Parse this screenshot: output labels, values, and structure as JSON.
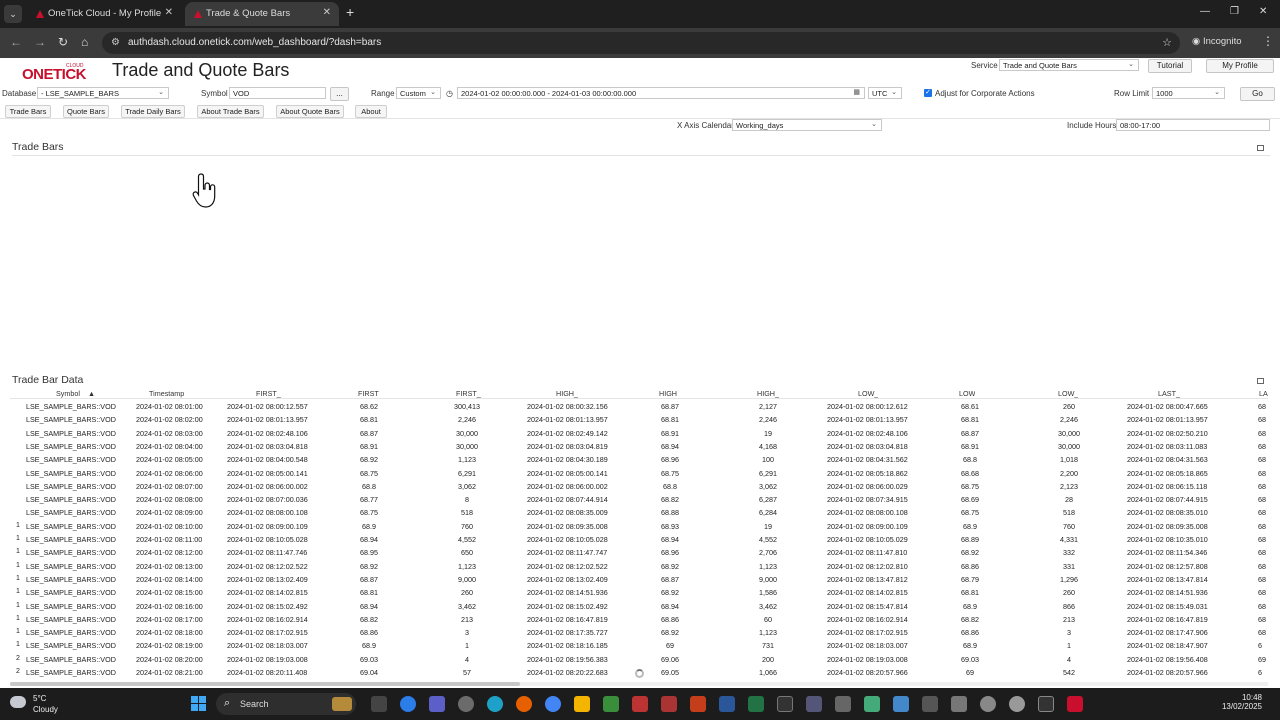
{
  "browser": {
    "tabs": [
      {
        "title": "OneTick Cloud - My Profile"
      },
      {
        "title": "Trade & Quote Bars"
      }
    ],
    "url": "authdash.cloud.onetick.com/web_dashboard/?dash=bars",
    "incognito_label": "Incognito"
  },
  "header": {
    "logo_text": "ONETICK",
    "logo_sub": "CLOUD",
    "title": "Trade and Quote Bars",
    "service_label": "Service",
    "service_value": "Trade and Quote Bars",
    "tutorial_label": "Tutorial",
    "profile_label": "My Profile"
  },
  "controls": {
    "database_label": "Database",
    "database_value": "- LSE_SAMPLE_BARS",
    "symbol_label": "Symbol",
    "symbol_value": "VOD",
    "symbol_more": "...",
    "range_label": "Range",
    "range_value": "Custom",
    "range_text": "2024-01-02 00:00:00.000 - 2024-01-03 00:00:00.000",
    "timezone": "UTC",
    "corp_actions_label": "Adjust for Corporate Actions",
    "row_limit_label": "Row Limit",
    "row_limit_value": "1000",
    "go_label": "Go"
  },
  "subtabs": [
    "Trade Bars",
    "Quote Bars",
    "Trade Daily Bars",
    "About Trade Bars",
    "About Quote Bars",
    "About"
  ],
  "options": {
    "x_axis_label": "X Axis Calendar",
    "x_axis_value": "Working_days",
    "include_hours_label": "Include Hours",
    "include_hours_value": "08:00-17:00"
  },
  "sections": {
    "chart_title": "Trade Bars",
    "table_title": "Trade Bar Data"
  },
  "table": {
    "columns": [
      "Symbol",
      "Timestamp",
      "FIRST_",
      "FIRST",
      "FIRST_",
      "HIGH_",
      "HIGH",
      "HIGH_",
      "LOW_",
      "LOW",
      "LOW_",
      "LAST_",
      "LA"
    ],
    "sort_indicator": "▲",
    "rows": [
      [
        "",
        "LSE_SAMPLE_BARS::VOD",
        "2024-01-02 08:01:00",
        "2024-01-02 08:00:12.557",
        "68.62",
        "300,413",
        "2024-01-02 08:00:32.156",
        "68.87",
        "2,127",
        "2024-01-02 08:00:12.612",
        "68.61",
        "260",
        "2024-01-02 08:00:47.665",
        "68"
      ],
      [
        "",
        "LSE_SAMPLE_BARS::VOD",
        "2024-01-02 08:02:00",
        "2024-01-02 08:01:13.957",
        "68.81",
        "2,246",
        "2024-01-02 08:01:13.957",
        "68.81",
        "2,246",
        "2024-01-02 08:01:13.957",
        "68.81",
        "2,246",
        "2024-01-02 08:01:13.957",
        "68"
      ],
      [
        "",
        "LSE_SAMPLE_BARS::VOD",
        "2024-01-02 08:03:00",
        "2024-01-02 08:02:48.106",
        "68.87",
        "30,000",
        "2024-01-02 08:02:49.142",
        "68.91",
        "19",
        "2024-01-02 08:02:48.106",
        "68.87",
        "30,000",
        "2024-01-02 08:02:50.210",
        "68"
      ],
      [
        "",
        "LSE_SAMPLE_BARS::VOD",
        "2024-01-02 08:04:00",
        "2024-01-02 08:03:04.818",
        "68.91",
        "30,000",
        "2024-01-02 08:03:04.819",
        "68.94",
        "4,168",
        "2024-01-02 08:03:04.818",
        "68.91",
        "30,000",
        "2024-01-02 08:03:11.083",
        "68"
      ],
      [
        "",
        "LSE_SAMPLE_BARS::VOD",
        "2024-01-02 08:05:00",
        "2024-01-02 08:04:00.548",
        "68.92",
        "1,123",
        "2024-01-02 08:04:30.189",
        "68.96",
        "100",
        "2024-01-02 08:04:31.562",
        "68.8",
        "1,018",
        "2024-01-02 08:04:31.563",
        "68"
      ],
      [
        "",
        "LSE_SAMPLE_BARS::VOD",
        "2024-01-02 08:06:00",
        "2024-01-02 08:05:00.141",
        "68.75",
        "6,291",
        "2024-01-02 08:05:00.141",
        "68.75",
        "6,291",
        "2024-01-02 08:05:18.862",
        "68.68",
        "2,200",
        "2024-01-02 08:05:18.865",
        "68"
      ],
      [
        "",
        "LSE_SAMPLE_BARS::VOD",
        "2024-01-02 08:07:00",
        "2024-01-02 08:06:00.002",
        "68.8",
        "3,062",
        "2024-01-02 08:06:00.002",
        "68.8",
        "3,062",
        "2024-01-02 08:06:00.029",
        "68.75",
        "2,123",
        "2024-01-02 08:06:15.118",
        "68"
      ],
      [
        "",
        "LSE_SAMPLE_BARS::VOD",
        "2024-01-02 08:08:00",
        "2024-01-02 08:07:00.036",
        "68.77",
        "8",
        "2024-01-02 08:07:44.914",
        "68.82",
        "6,287",
        "2024-01-02 08:07:34.915",
        "68.69",
        "28",
        "2024-01-02 08:07:44.915",
        "68"
      ],
      [
        "",
        "LSE_SAMPLE_BARS::VOD",
        "2024-01-02 08:09:00",
        "2024-01-02 08:08:00.108",
        "68.75",
        "518",
        "2024-01-02 08:08:35.009",
        "68.88",
        "6,284",
        "2024-01-02 08:08:00.108",
        "68.75",
        "518",
        "2024-01-02 08:08:35.010",
        "68"
      ],
      [
        "1",
        "LSE_SAMPLE_BARS::VOD",
        "2024-01-02 08:10:00",
        "2024-01-02 08:09:00.109",
        "68.9",
        "760",
        "2024-01-02 08:09:35.008",
        "68.93",
        "19",
        "2024-01-02 08:09:00.109",
        "68.9",
        "760",
        "2024-01-02 08:09:35.008",
        "68"
      ],
      [
        "1",
        "LSE_SAMPLE_BARS::VOD",
        "2024-01-02 08:11:00",
        "2024-01-02 08:10:05.028",
        "68.94",
        "4,552",
        "2024-01-02 08:10:05.028",
        "68.94",
        "4,552",
        "2024-01-02 08:10:05.029",
        "68.89",
        "4,331",
        "2024-01-02 08:10:35.010",
        "68"
      ],
      [
        "1",
        "LSE_SAMPLE_BARS::VOD",
        "2024-01-02 08:12:00",
        "2024-01-02 08:11:47.746",
        "68.95",
        "650",
        "2024-01-02 08:11:47.747",
        "68.96",
        "2,706",
        "2024-01-02 08:11:47.810",
        "68.92",
        "332",
        "2024-01-02 08:11:54.346",
        "68"
      ],
      [
        "1",
        "LSE_SAMPLE_BARS::VOD",
        "2024-01-02 08:13:00",
        "2024-01-02 08:12:02.522",
        "68.92",
        "1,123",
        "2024-01-02 08:12:02.522",
        "68.92",
        "1,123",
        "2024-01-02 08:12:02.810",
        "68.86",
        "331",
        "2024-01-02 08:12:57.808",
        "68"
      ],
      [
        "1",
        "LSE_SAMPLE_BARS::VOD",
        "2024-01-02 08:14:00",
        "2024-01-02 08:13:02.409",
        "68.87",
        "9,000",
        "2024-01-02 08:13:02.409",
        "68.87",
        "9,000",
        "2024-01-02 08:13:47.812",
        "68.79",
        "1,296",
        "2024-01-02 08:13:47.814",
        "68"
      ],
      [
        "1",
        "LSE_SAMPLE_BARS::VOD",
        "2024-01-02 08:15:00",
        "2024-01-02 08:14:02.815",
        "68.81",
        "260",
        "2024-01-02 08:14:51.936",
        "68.92",
        "1,586",
        "2024-01-02 08:14:02.815",
        "68.81",
        "260",
        "2024-01-02 08:14:51.936",
        "68"
      ],
      [
        "1",
        "LSE_SAMPLE_BARS::VOD",
        "2024-01-02 08:16:00",
        "2024-01-02 08:15:02.492",
        "68.94",
        "3,462",
        "2024-01-02 08:15:02.492",
        "68.94",
        "3,462",
        "2024-01-02 08:15:47.814",
        "68.9",
        "866",
        "2024-01-02 08:15:49.031",
        "68"
      ],
      [
        "1",
        "LSE_SAMPLE_BARS::VOD",
        "2024-01-02 08:17:00",
        "2024-01-02 08:16:02.914",
        "68.82",
        "213",
        "2024-01-02 08:16:47.819",
        "68.86",
        "60",
        "2024-01-02 08:16:02.914",
        "68.82",
        "213",
        "2024-01-02 08:16:47.819",
        "68"
      ],
      [
        "1",
        "LSE_SAMPLE_BARS::VOD",
        "2024-01-02 08:18:00",
        "2024-01-02 08:17:02.915",
        "68.86",
        "3",
        "2024-01-02 08:17:35.727",
        "68.92",
        "1,123",
        "2024-01-02 08:17:02.915",
        "68.86",
        "3",
        "2024-01-02 08:17:47.906",
        "68"
      ],
      [
        "1",
        "LSE_SAMPLE_BARS::VOD",
        "2024-01-02 08:19:00",
        "2024-01-02 08:18:03.007",
        "68.9",
        "1",
        "2024-01-02 08:18:16.185",
        "69",
        "731",
        "2024-01-02 08:18:03.007",
        "68.9",
        "1",
        "2024-01-02 08:18:47.907",
        "6"
      ],
      [
        "2",
        "LSE_SAMPLE_BARS::VOD",
        "2024-01-02 08:20:00",
        "2024-01-02 08:19:03.008",
        "69.03",
        "4",
        "2024-01-02 08:19:56.383",
        "69.06",
        "200",
        "2024-01-02 08:19:03.008",
        "69.03",
        "4",
        "2024-01-02 08:19:56.408",
        "69"
      ],
      [
        "2",
        "LSE_SAMPLE_BARS::VOD",
        "2024-01-02 08:21:00",
        "2024-01-02 08:20:11.408",
        "69.04",
        "57",
        "2024-01-02 08:20:22.683",
        "69.05",
        "1,066",
        "2024-01-02 08:20:57.966",
        "69",
        "542",
        "2024-01-02 08:20:57.966",
        "6"
      ]
    ]
  },
  "taskbar": {
    "temperature": "5°C",
    "condition": "Cloudy",
    "search_placeholder": "Search",
    "time": "10:48",
    "date": "13/02/2025"
  },
  "colors": {
    "brand_red": "#c8102e",
    "chrome_dark": "#1f1f1f",
    "checkbox_blue": "#1a73e8"
  }
}
